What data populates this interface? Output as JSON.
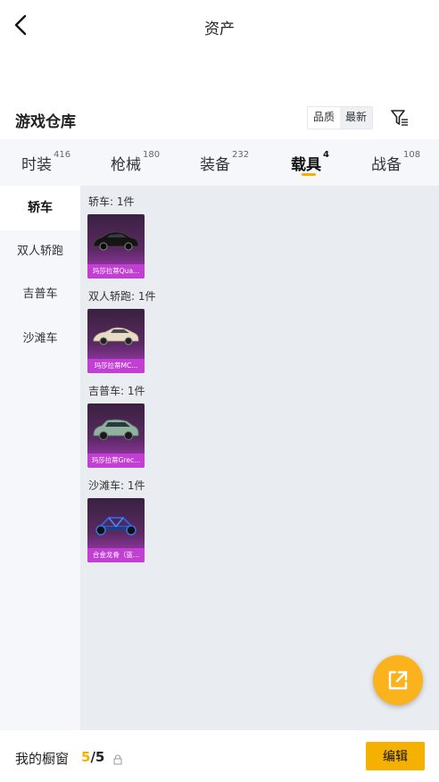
{
  "header": {
    "title": "资产"
  },
  "warehouse": {
    "title": "游戏仓库",
    "sort_quality": "品质",
    "sort_latest": "最新"
  },
  "tabs": [
    {
      "label": "时装",
      "count": "416"
    },
    {
      "label": "枪械",
      "count": "180"
    },
    {
      "label": "装备",
      "count": "232"
    },
    {
      "label": "载具",
      "count": "4",
      "active": true
    },
    {
      "label": "战备",
      "count": "108"
    }
  ],
  "sidebar": {
    "items": [
      {
        "label": "轿车",
        "active": true
      },
      {
        "label": "双人轿跑"
      },
      {
        "label": "吉普车"
      },
      {
        "label": "沙滩车"
      }
    ]
  },
  "groups": [
    {
      "label": "轿车: 1件",
      "item_name": "玛莎拉蒂Qua...",
      "car_color": "#1a1a1a"
    },
    {
      "label": "双人轿跑: 1件",
      "item_name": "玛莎拉蒂MC...",
      "car_color": "#e8dcc6"
    },
    {
      "label": "吉普车: 1件",
      "item_name": "玛莎拉蒂Grec...",
      "car_color": "#8fb3a0"
    },
    {
      "label": "沙滩车: 1件",
      "item_name": "合金龙骨（蓝...",
      "car_color": "#2458c8"
    }
  ],
  "footer": {
    "label": "我的橱窗",
    "current": "5",
    "separator": "/",
    "total": "5",
    "edit_label": "编辑"
  },
  "colors": {
    "accent": "#f5b100",
    "card_purple": "#c23fd3"
  }
}
